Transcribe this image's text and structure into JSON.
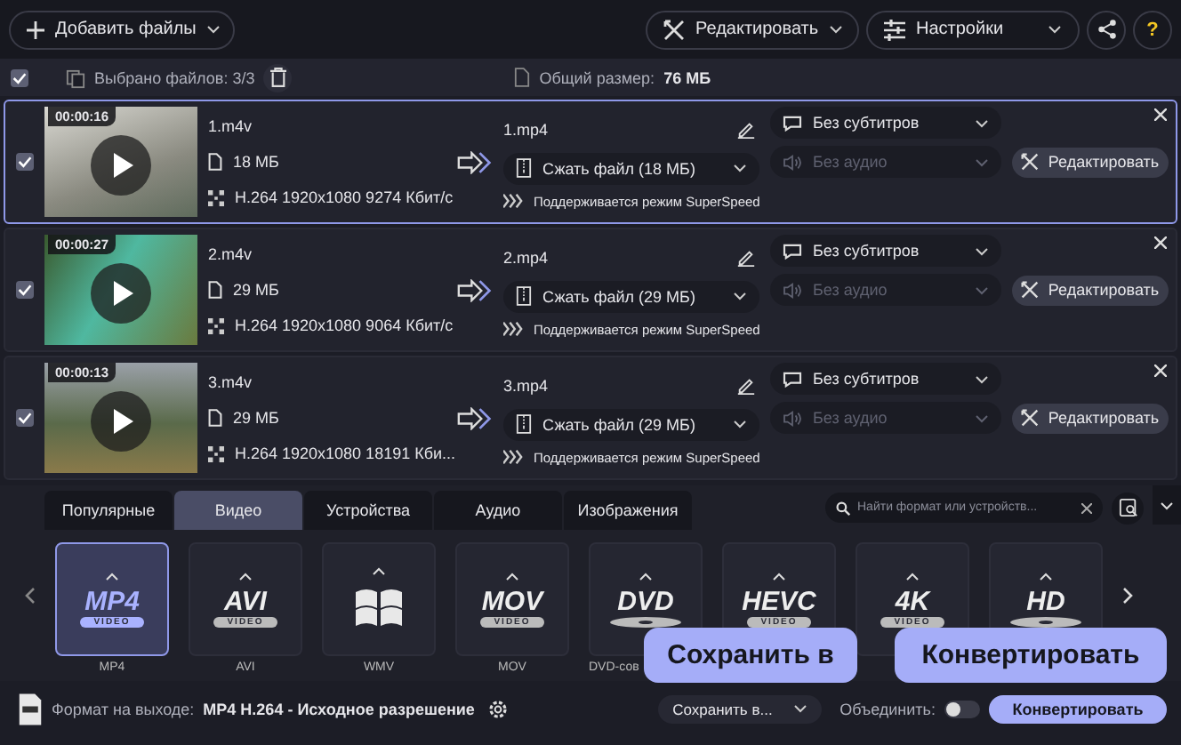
{
  "toolbar": {
    "add_files": "Добавить файлы",
    "edit": "Редактировать",
    "settings": "Настройки",
    "help": "?"
  },
  "selection": {
    "all_checked": true,
    "selected": "Выбрано файлов: 3/3",
    "total_label": "Общий размер:",
    "total_value": "76 МБ"
  },
  "files": [
    {
      "selected": true,
      "checked": true,
      "duration": "00:00:16",
      "source": "1.m4v",
      "size": "18 МБ",
      "codec": "H.264 1920x1080 9274 Кбит/с",
      "output": "1.mp4",
      "compress": "Сжать файл (18 МБ)",
      "superspeed": "Поддерживается режим SuperSpeed",
      "subtitles": "Без субтитров",
      "audio": "Без аудио",
      "audio_disabled": true,
      "edit": "Редактировать"
    },
    {
      "selected": false,
      "checked": true,
      "duration": "00:00:27",
      "source": "2.m4v",
      "size": "29 МБ",
      "codec": "H.264 1920x1080 9064 Кбит/с",
      "output": "2.mp4",
      "compress": "Сжать файл (29 МБ)",
      "superspeed": "Поддерживается режим SuperSpeed",
      "subtitles": "Без субтитров",
      "audio": "Без аудио",
      "audio_disabled": true,
      "edit": "Редактировать"
    },
    {
      "selected": false,
      "checked": true,
      "duration": "00:00:13",
      "source": "3.m4v",
      "size": "29 МБ",
      "codec": "H.264 1920x1080 18191 Кби...",
      "output": "3.mp4",
      "compress": "Сжать файл (29 МБ)",
      "superspeed": "Поддерживается режим SuperSpeed",
      "subtitles": "Без субтитров",
      "audio": "Без аудио",
      "audio_disabled": true,
      "edit": "Редактировать"
    }
  ],
  "format_tabs": [
    {
      "label": "Популярные",
      "selected": false
    },
    {
      "label": "Видео",
      "selected": true
    },
    {
      "label": "Устройства",
      "selected": false
    },
    {
      "label": "Аудио",
      "selected": false
    },
    {
      "label": "Изображения",
      "selected": false
    }
  ],
  "search": {
    "placeholder": "Найти формат или устройств..."
  },
  "formats": [
    {
      "kind": "text",
      "logo": "MP4",
      "sub": "VIDEO",
      "label": "MP4",
      "selected": true
    },
    {
      "kind": "text",
      "logo": "AVI",
      "sub": "VIDEO",
      "label": "AVI",
      "selected": false
    },
    {
      "kind": "windows",
      "label": "WMV",
      "selected": false
    },
    {
      "kind": "text",
      "logo": "MOV",
      "sub": "VIDEO",
      "label": "MOV",
      "selected": false
    },
    {
      "kind": "disc",
      "logo": "DVD",
      "label": "DVD-сов",
      "selected": false
    },
    {
      "kind": "text",
      "logo": "HEVC",
      "sub": "VIDEO",
      "selected": false
    },
    {
      "kind": "text",
      "logo": "4K",
      "sub": "VIDEO",
      "selected": false
    },
    {
      "kind": "disc",
      "logo": "HD",
      "selected": false
    }
  ],
  "output": {
    "label": "Формат на выходе:",
    "value": "MP4 H.264 - Исходное разрешение",
    "save_to": "Сохранить в...",
    "merge_label": "Объединить:",
    "merge_on": false,
    "convert": "Конвертировать"
  },
  "callouts": [
    {
      "kind": "save",
      "text": "Сохранить в"
    },
    {
      "kind": "convert",
      "text": "Конвертировать"
    }
  ]
}
